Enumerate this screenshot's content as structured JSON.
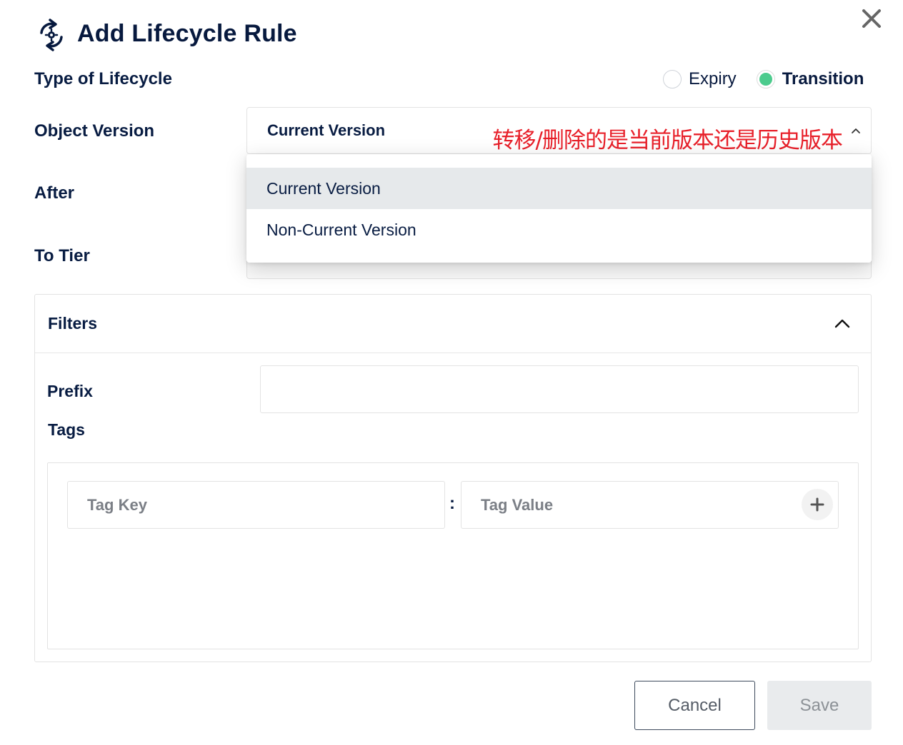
{
  "header": {
    "title": "Add Lifecycle Rule",
    "title_icon": "lifecycle-refresh-gear-icon",
    "close_icon": "close-icon"
  },
  "form": {
    "type_label": "Type of Lifecycle",
    "type_options": [
      {
        "label": "Expiry",
        "selected": false
      },
      {
        "label": "Transition",
        "selected": true
      }
    ],
    "object_version_label": "Object Version",
    "object_version_value": "Current Version",
    "object_version_options": [
      "Current Version",
      "Non-Current Version"
    ],
    "highlighted_option": "Current Version",
    "annotation": "转移/删除的是当前版本还是历史版本",
    "after_label": "After",
    "to_tier_label": "To Tier"
  },
  "filters": {
    "title": "Filters",
    "prefix_label": "Prefix",
    "tags_label": "Tags",
    "tag_key_placeholder": "Tag Key",
    "tag_separator": ":",
    "tag_value_placeholder": "Tag Value"
  },
  "actions": {
    "cancel_label": "Cancel",
    "save_label": "Save"
  },
  "colors": {
    "text_primary": "#081c42",
    "radio_selected": "#4ccb8d",
    "annotation_red": "#e8202a",
    "highlight_bg": "#e6e9eb",
    "save_disabled_bg": "#e9ebed"
  }
}
